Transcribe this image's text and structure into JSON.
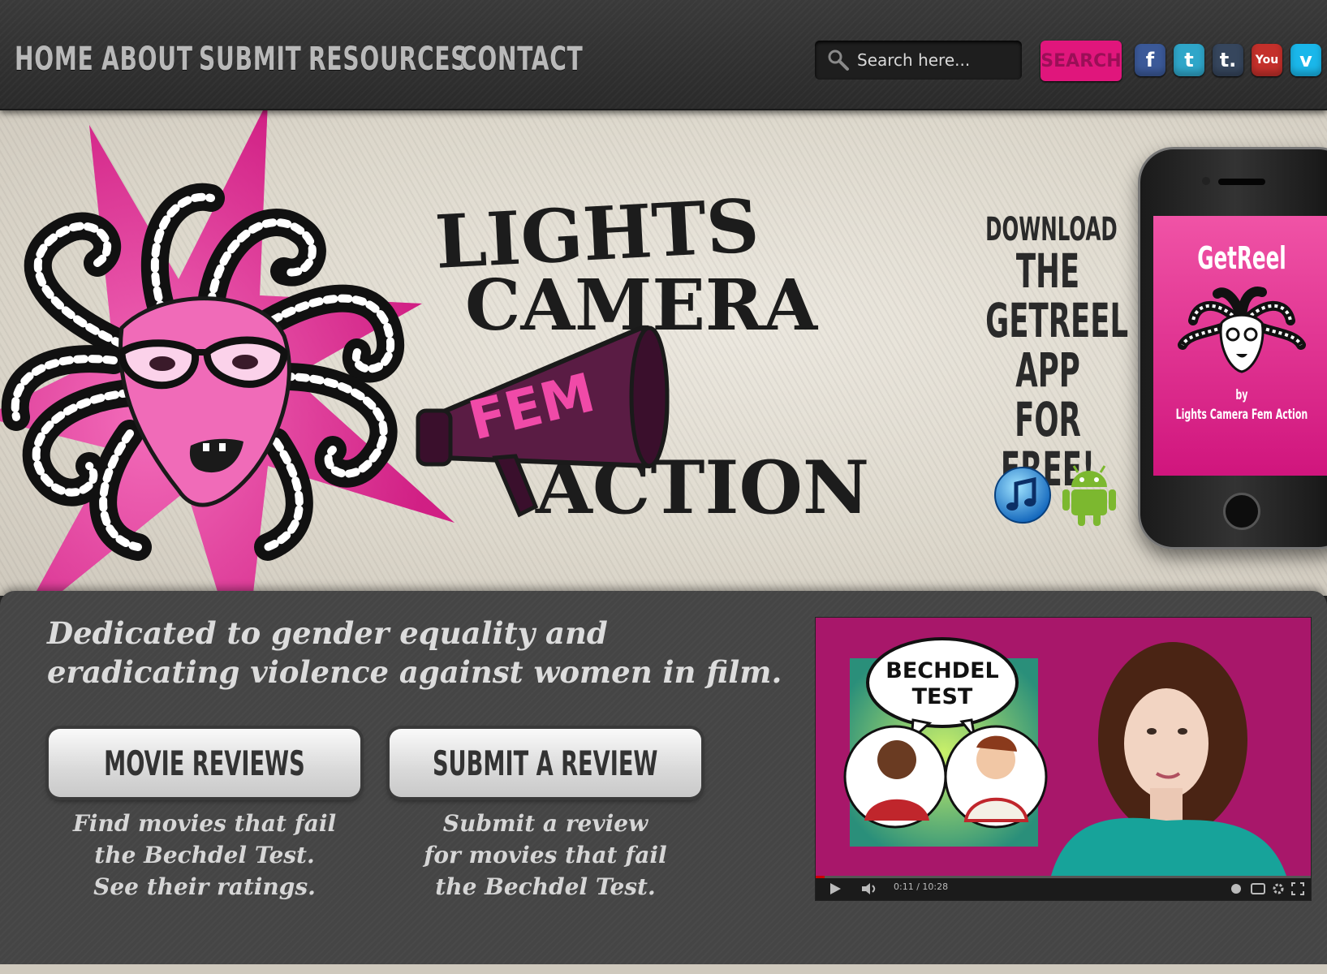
{
  "nav": {
    "items": [
      "HOME",
      "ABOUT",
      "SUBMIT",
      "RESOURCES",
      "CONTACT"
    ]
  },
  "search": {
    "placeholder": "Search here...",
    "button_label": "SEARCH"
  },
  "social": {
    "icons": [
      "facebook-icon",
      "twitter-icon",
      "tumblr-icon",
      "youtube-icon",
      "vimeo-icon"
    ],
    "glyphs": [
      "f",
      "t",
      "t.",
      "You",
      "v"
    ],
    "colors": [
      "#3b5998",
      "#2fa6c9",
      "#36465d",
      "#c4302b",
      "#1ab7ea"
    ]
  },
  "logo": {
    "line1": "LIGHTS",
    "line2": "CAMERA",
    "fem": "FEM",
    "line3": "ACTION"
  },
  "download": {
    "lines": [
      "DOWNLOAD",
      "THE",
      "GETREEL",
      "APP FOR",
      "FREE!"
    ]
  },
  "phone": {
    "app_name": "GetReel",
    "by": "by",
    "org": "Lights Camera Fem Action"
  },
  "tagline": "Dedicated to gender equality and eradicating violence against women in film.",
  "cta": [
    {
      "label": "MOVIE REVIEWS",
      "desc": [
        "Find movies that fail",
        "the Bechdel Test.",
        "See their ratings."
      ]
    },
    {
      "label": "SUBMIT A REVIEW",
      "desc": [
        "Submit a review",
        "for movies that fail",
        "the Bechdel Test."
      ]
    }
  ],
  "video": {
    "bubble_line1": "BECHDEL",
    "bubble_line2": "TEST",
    "time": "0:11 / 10:28",
    "progress": 0.018
  },
  "colors": {
    "accent_pink": "#e0167c",
    "hero_pink": "#e5269b",
    "dark_bar": "#2e2e2e"
  }
}
